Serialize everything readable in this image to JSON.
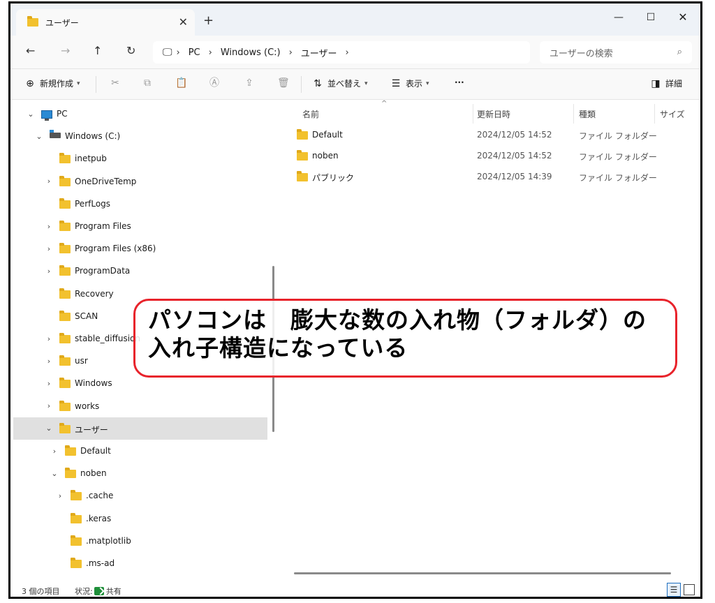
{
  "window": {
    "tab_title": "ユーザー",
    "tab_close": "✕",
    "new_tab": "+",
    "minimize": "—",
    "maximize": "☐",
    "close": "✕"
  },
  "address": {
    "crumbs": [
      "PC",
      "Windows (C:)",
      "ユーザー"
    ],
    "search_placeholder": "ユーザーの検索"
  },
  "toolbar": {
    "new_label": "新規作成",
    "sort_label": "並べ替え",
    "view_label": "表示",
    "more_label": "···",
    "details_label": "詳細"
  },
  "nav_tree": [
    {
      "label": "PC",
      "icon": "pc-icon",
      "indent": 0,
      "expanded": true
    },
    {
      "label": "Windows (C:)",
      "icon": "drive-icon",
      "indent": 1,
      "expanded": true
    },
    {
      "label": "inetpub",
      "icon": "folder-icon",
      "indent": 2,
      "twisty": false
    },
    {
      "label": "OneDriveTemp",
      "icon": "folder-icon",
      "indent": 2,
      "twisty": true
    },
    {
      "label": "PerfLogs",
      "icon": "folder-icon",
      "indent": 2,
      "twisty": false
    },
    {
      "label": "Program Files",
      "icon": "folder-icon",
      "indent": 2,
      "twisty": true
    },
    {
      "label": "Program Files (x86)",
      "icon": "folder-icon",
      "indent": 2,
      "twisty": true
    },
    {
      "label": "ProgramData",
      "icon": "folder-icon",
      "indent": 2,
      "twisty": true
    },
    {
      "label": "Recovery",
      "icon": "folder-icon",
      "indent": 2,
      "twisty": false
    },
    {
      "label": "SCAN",
      "icon": "folder-icon",
      "indent": 2,
      "twisty": false
    },
    {
      "label": "stable_diffusion",
      "icon": "folder-icon",
      "indent": 2,
      "twisty": true
    },
    {
      "label": "usr",
      "icon": "folder-icon",
      "indent": 2,
      "twisty": true
    },
    {
      "label": "Windows",
      "icon": "folder-icon",
      "indent": 2,
      "twisty": true
    },
    {
      "label": "works",
      "icon": "folder-icon",
      "indent": 2,
      "twisty": true
    },
    {
      "label": "ユーザー",
      "icon": "folder-icon",
      "indent": 2,
      "expanded": true,
      "selected": true
    },
    {
      "label": "Default",
      "icon": "folder-icon",
      "indent": 3,
      "twisty": true
    },
    {
      "label": "noben",
      "icon": "folder-icon",
      "indent": 3,
      "expanded": true
    },
    {
      "label": ".cache",
      "icon": "folder-icon",
      "indent": 4,
      "twisty": true
    },
    {
      "label": ".keras",
      "icon": "folder-icon",
      "indent": 4,
      "twisty": false
    },
    {
      "label": ".matplotlib",
      "icon": "folder-icon",
      "indent": 4,
      "twisty": false
    },
    {
      "label": ".ms-ad",
      "icon": "folder-icon",
      "indent": 4,
      "twisty": false
    }
  ],
  "columns": {
    "name": "名前",
    "date": "更新日時",
    "type": "種類",
    "size": "サイズ"
  },
  "files": [
    {
      "name": "Default",
      "date": "2024/12/05 14:52",
      "type": "ファイル フォルダー"
    },
    {
      "name": "noben",
      "date": "2024/12/05 14:52",
      "type": "ファイル フォルダー"
    },
    {
      "name": "パブリック",
      "date": "2024/12/05 14:39",
      "type": "ファイル フォルダー"
    }
  ],
  "status": {
    "count": "3 個の項目",
    "state_label": "状況:",
    "share_label": "共有"
  },
  "callout": {
    "line1": "パソコンは　膨大な数の入れ物（フォルダ）の",
    "line2": "入れ子構造になっている",
    "border_color": "#e8232b"
  }
}
